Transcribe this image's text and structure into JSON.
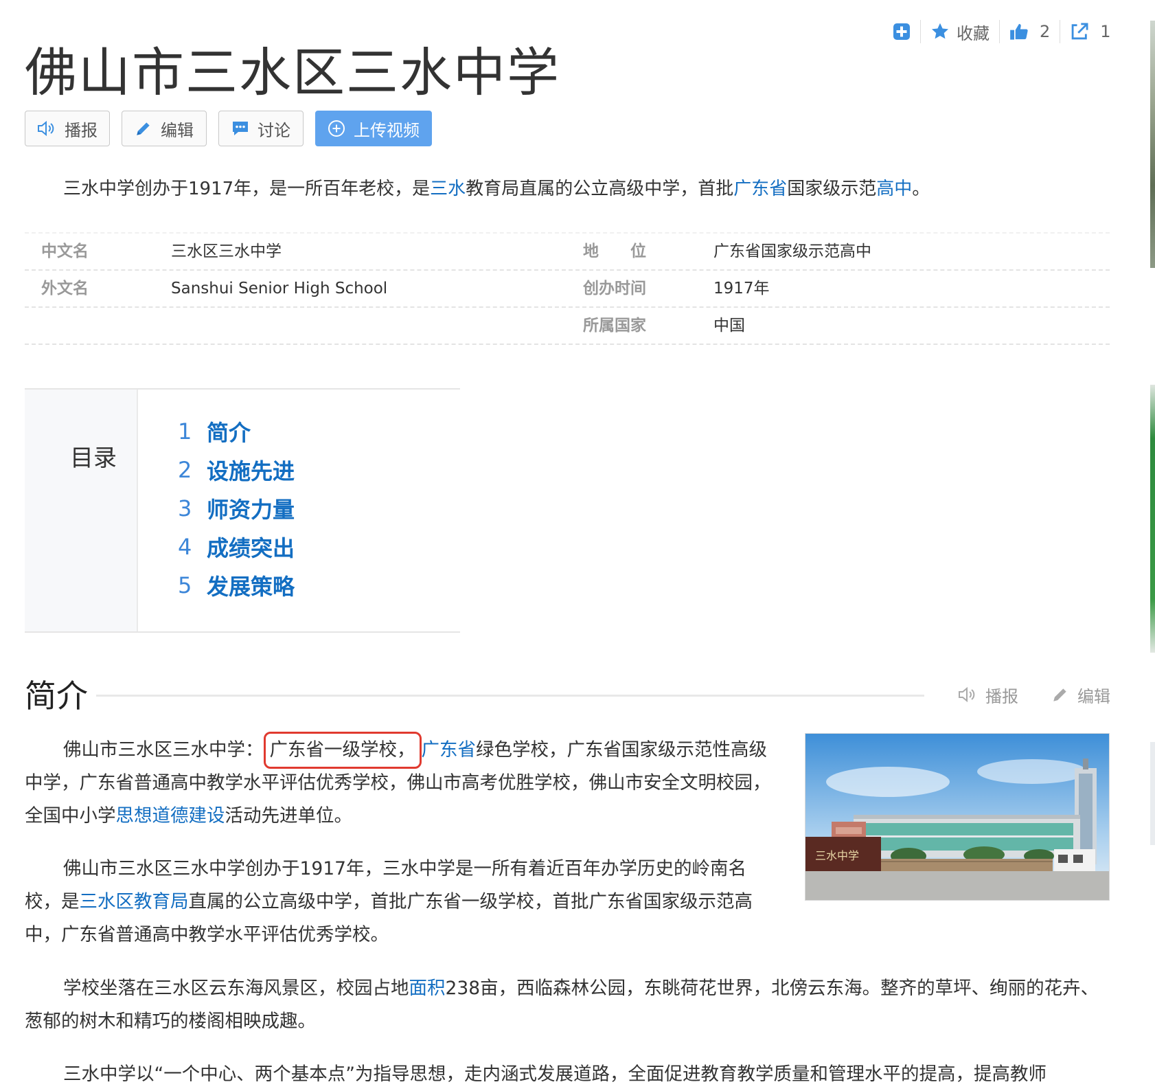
{
  "top_actions": {
    "favorite_label": "收藏",
    "like_count": "2",
    "share_count": "1"
  },
  "title": "佛山市三水区三水中学",
  "buttons": {
    "broadcast": "播报",
    "edit": "编辑",
    "discuss": "讨论",
    "upload_video": "上传视频"
  },
  "summary": {
    "t1": "三水中学创办于1917年，是一所百年老校，是",
    "l1": "三水",
    "t2": "教育局直属的公立高级中学，首批",
    "l2": "广东省",
    "t3": "国家级示范",
    "l3": "高中",
    "t4": "。"
  },
  "info": {
    "chinese_name": {
      "key": "中文名",
      "value": "三水区三水中学"
    },
    "foreign_name": {
      "key": "外文名",
      "value": "Sanshui Senior High School"
    },
    "status": {
      "key": "地　　位",
      "value": "广东省国家级示范高中"
    },
    "founded": {
      "key": "创办时间",
      "value": "1917年"
    },
    "country": {
      "key": "所属国家",
      "value": "中国"
    }
  },
  "catalog": {
    "title": "目录",
    "items": [
      {
        "num": "1",
        "label": "简介"
      },
      {
        "num": "2",
        "label": "设施先进"
      },
      {
        "num": "3",
        "label": "师资力量"
      },
      {
        "num": "4",
        "label": "成绩突出"
      },
      {
        "num": "5",
        "label": "发展策略"
      }
    ]
  },
  "section": {
    "title": "简介",
    "broadcast": "播报",
    "edit": "编辑"
  },
  "paragraphs": {
    "p1": {
      "a": "佛山市三水区三水中学：",
      "highlight": "广东省一级学校，",
      "link1": "广东省",
      "b": "绿色学校，广东省国家级示范性高级中学，广东省普通高中教学水平评估优秀学校，佛山市高考优胜学校，佛山市安全文明校园，全国中小学",
      "link2": "思想道德建设",
      "c": "活动先进单位。"
    },
    "p2": {
      "a": "佛山市三水区三水中学创办于1917年，三水中学是一所有着近百年办学历史的岭南名校，是",
      "link": "三水区教育局",
      "b": "直属的公立高级中学，首批广东省一级学校，首批广东省国家级示范高中，广东省普通高中教学水平评估优秀学校。"
    },
    "p3": {
      "a": "学校坐落在三水区云东海风景区，校园占地",
      "link": "面积",
      "b": "238亩，西临森林公园，东眺荷花世界，北傍云东海。整齐的草坪、绚丽的花卉、葱郁的树木和精巧的楼阁相映成趣。"
    },
    "p4": {
      "a": "三水中学以“一个中心、两个基本点”为指导思想，走内涵式发展道路，全面促进教育教学质量和管理水平的提高，提高教师"
    }
  },
  "photo": {
    "sign_text": "三水中学"
  },
  "colors": {
    "link": "#136ec2",
    "primary_button": "#5fa3ee",
    "highlight_box": "#e03a2f"
  }
}
